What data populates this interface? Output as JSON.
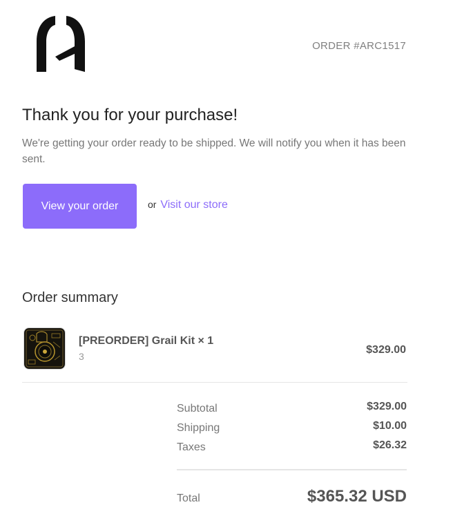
{
  "header": {
    "logo_icon": "arch-logo-icon",
    "order_number": "ORDER #ARC1517"
  },
  "hero": {
    "title": "Thank you for your purchase!",
    "subtitle": "We're getting your order ready to be shipped. We will notify you when it has been sent.",
    "view_order_label": "View your order",
    "or_text": "or",
    "visit_store_label": "Visit our store"
  },
  "summary": {
    "title": "Order summary",
    "items": [
      {
        "thumbnail_icon": "product-thumbnail",
        "name": "[PREORDER] Grail Kit × 1",
        "variant": "3",
        "price": "$329.00"
      }
    ],
    "subtotal_label": "Subtotal",
    "subtotal_value": "$329.00",
    "shipping_label": "Shipping",
    "shipping_value": "$10.00",
    "taxes_label": "Taxes",
    "taxes_value": "$26.32",
    "total_label": "Total",
    "total_value": "$365.32 USD"
  },
  "colors": {
    "accent": "#8c6cfa",
    "text_dark": "#222222",
    "text_muted": "#777777"
  }
}
